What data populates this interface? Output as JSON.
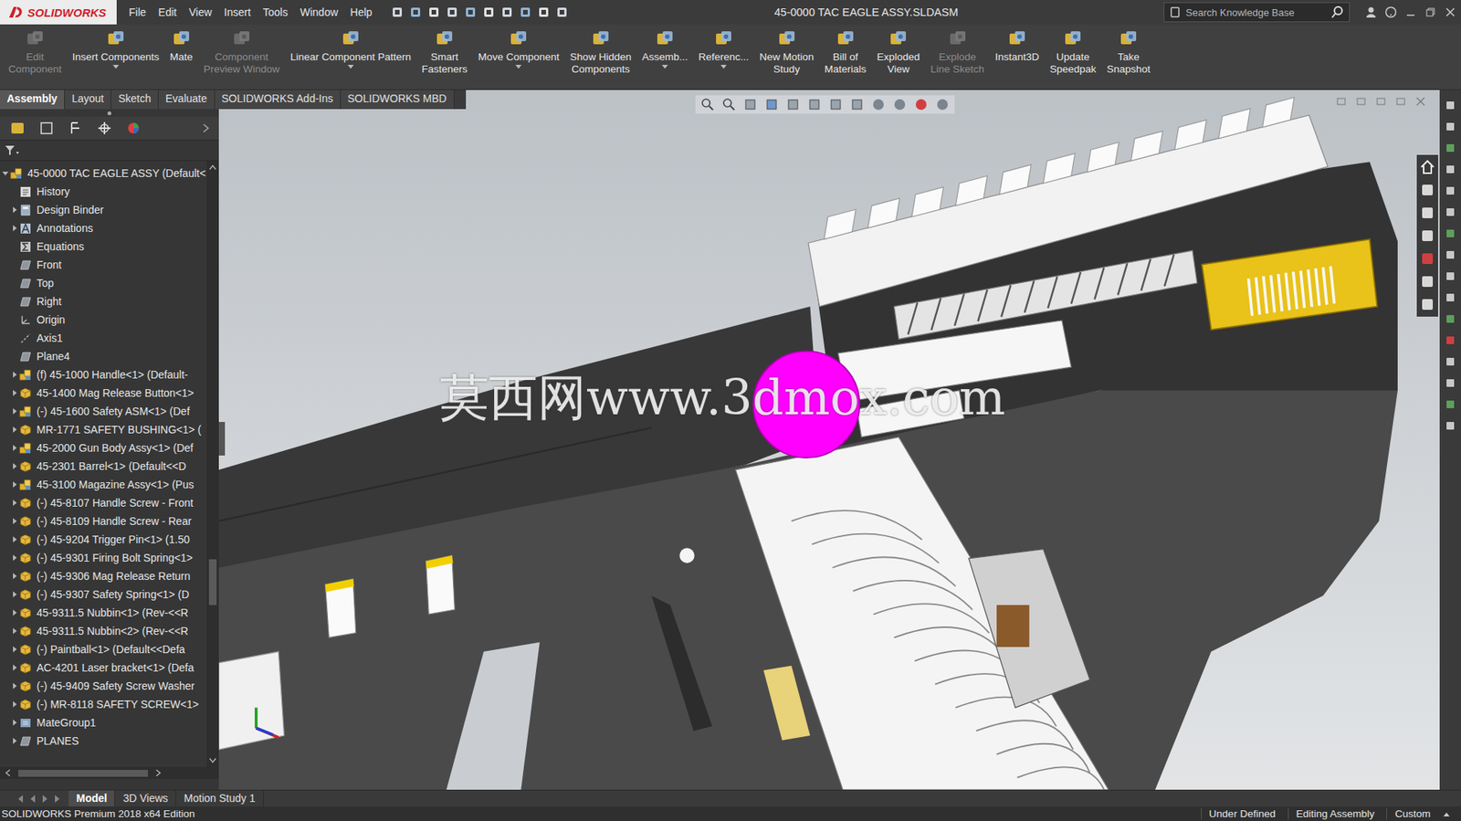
{
  "app": {
    "logo": "SOLIDWORKS",
    "title": "45-0000 TAC EAGLE ASSY.SLDASM",
    "menus": [
      "File",
      "Edit",
      "View",
      "Insert",
      "Tools",
      "Window",
      "Help"
    ],
    "search": {
      "placeholder": "Search Knowledge Base"
    }
  },
  "commands": [
    {
      "lines": [
        "Edit",
        "Component"
      ],
      "disabled": true,
      "dropdown": false
    },
    {
      "lines": [
        "Insert Components"
      ],
      "disabled": false,
      "dropdown": true
    },
    {
      "lines": [
        "Mate"
      ],
      "disabled": false,
      "dropdown": false
    },
    {
      "lines": [
        "Component",
        "Preview Window"
      ],
      "disabled": true,
      "dropdown": false
    },
    {
      "lines": [
        "Linear Component Pattern"
      ],
      "disabled": false,
      "dropdown": true
    },
    {
      "lines": [
        "Smart",
        "Fasteners"
      ],
      "disabled": false,
      "dropdown": false
    },
    {
      "lines": [
        "Move Component"
      ],
      "disabled": false,
      "dropdown": true
    },
    {
      "lines": [
        "Show Hidden",
        "Components"
      ],
      "disabled": false,
      "dropdown": false
    },
    {
      "lines": [
        "Assemb..."
      ],
      "disabled": false,
      "dropdown": true
    },
    {
      "lines": [
        "Referenc..."
      ],
      "disabled": false,
      "dropdown": true
    },
    {
      "lines": [
        "New Motion",
        "Study"
      ],
      "disabled": false,
      "dropdown": false
    },
    {
      "lines": [
        "Bill of",
        "Materials"
      ],
      "disabled": false,
      "dropdown": false
    },
    {
      "lines": [
        "Exploded",
        "View"
      ],
      "disabled": false,
      "dropdown": false
    },
    {
      "lines": [
        "Explode",
        "Line Sketch"
      ],
      "disabled": true,
      "dropdown": false
    },
    {
      "lines": [
        "Instant3D"
      ],
      "disabled": false,
      "dropdown": false
    },
    {
      "lines": [
        "Update",
        "Speedpak"
      ],
      "disabled": false,
      "dropdown": false
    },
    {
      "lines": [
        "Take",
        "Snapshot"
      ],
      "disabled": false,
      "dropdown": false
    }
  ],
  "tabs": [
    {
      "label": "Assembly",
      "selected": true
    },
    {
      "label": "Layout",
      "selected": false
    },
    {
      "label": "Sketch",
      "selected": false
    },
    {
      "label": "Evaluate",
      "selected": false
    },
    {
      "label": "SOLIDWORKS Add-Ins",
      "selected": false
    },
    {
      "label": "SOLIDWORKS MBD",
      "selected": false
    }
  ],
  "tree": {
    "items": [
      {
        "label": "45-0000 TAC EAGLE ASSY  (Default<",
        "kind": "assembly",
        "depth": 0,
        "expandable": true,
        "expanded": true
      },
      {
        "label": "History",
        "kind": "history",
        "depth": 1,
        "expandable": false,
        "expanded": false
      },
      {
        "label": "Design Binder",
        "kind": "binder",
        "depth": 1,
        "expandable": true,
        "expanded": false
      },
      {
        "label": "Annotations",
        "kind": "annotation",
        "depth": 1,
        "expandable": true,
        "expanded": false
      },
      {
        "label": "Equations",
        "kind": "equation",
        "depth": 1,
        "expandable": false,
        "expanded": false
      },
      {
        "label": "Front",
        "kind": "plane",
        "depth": 1,
        "expandable": false,
        "expanded": false
      },
      {
        "label": "Top",
        "kind": "plane",
        "depth": 1,
        "expandable": false,
        "expanded": false
      },
      {
        "label": "Right",
        "kind": "plane",
        "depth": 1,
        "expandable": false,
        "expanded": false
      },
      {
        "label": "Origin",
        "kind": "origin",
        "depth": 1,
        "expandable": false,
        "expanded": false
      },
      {
        "label": "Axis1",
        "kind": "axis",
        "depth": 1,
        "expandable": false,
        "expanded": false
      },
      {
        "label": "Plane4",
        "kind": "plane",
        "depth": 1,
        "expandable": false,
        "expanded": false
      },
      {
        "label": "(f) 45-1000 Handle<1> (Default-",
        "kind": "assembly",
        "depth": 1,
        "expandable": true,
        "expanded": false
      },
      {
        "label": "45-1400 Mag Release Button<1>",
        "kind": "part",
        "depth": 1,
        "expandable": true,
        "expanded": false
      },
      {
        "label": "(-) 45-1600 Safety ASM<1> (Def",
        "kind": "assembly",
        "depth": 1,
        "expandable": true,
        "expanded": false
      },
      {
        "label": "MR-1771 SAFETY BUSHING<1> (",
        "kind": "part",
        "depth": 1,
        "expandable": true,
        "expanded": false
      },
      {
        "label": "45-2000 Gun Body Assy<1> (Def",
        "kind": "assembly",
        "depth": 1,
        "expandable": true,
        "expanded": false
      },
      {
        "label": "45-2301 Barrel<1> (Default<<D",
        "kind": "part",
        "depth": 1,
        "expandable": true,
        "expanded": false
      },
      {
        "label": "45-3100 Magazine Assy<1> (Pus",
        "kind": "assembly",
        "depth": 1,
        "expandable": true,
        "expanded": false
      },
      {
        "label": "(-) 45-8107 Handle Screw - Front",
        "kind": "part",
        "depth": 1,
        "expandable": true,
        "expanded": false
      },
      {
        "label": "(-) 45-8109 Handle Screw - Rear",
        "kind": "part",
        "depth": 1,
        "expandable": true,
        "expanded": false
      },
      {
        "label": "(-) 45-9204 Trigger Pin<1> (1.50",
        "kind": "part",
        "depth": 1,
        "expandable": true,
        "expanded": false
      },
      {
        "label": "(-) 45-9301 Firing Bolt Spring<1>",
        "kind": "part",
        "depth": 1,
        "expandable": true,
        "expanded": false
      },
      {
        "label": "(-) 45-9306 Mag Release Return",
        "kind": "part",
        "depth": 1,
        "expandable": true,
        "expanded": false
      },
      {
        "label": "(-) 45-9307 Safety Spring<1> (D",
        "kind": "part",
        "depth": 1,
        "expandable": true,
        "expanded": false
      },
      {
        "label": "45-9311.5 Nubbin<1> (Rev-<<R",
        "kind": "part",
        "depth": 1,
        "expandable": true,
        "expanded": false
      },
      {
        "label": "45-9311.5 Nubbin<2> (Rev-<<R",
        "kind": "part",
        "depth": 1,
        "expandable": true,
        "expanded": false
      },
      {
        "label": "(-) Paintball<1> (Default<<Defa",
        "kind": "part",
        "depth": 1,
        "expandable": true,
        "expanded": false
      },
      {
        "label": "AC-4201 Laser bracket<1> (Defa",
        "kind": "part",
        "depth": 1,
        "expandable": true,
        "expanded": false
      },
      {
        "label": "(-) 45-9409 Safety Screw Washer",
        "kind": "part",
        "depth": 1,
        "expandable": true,
        "expanded": false
      },
      {
        "label": "(-) MR-8118 SAFETY SCREW<1>",
        "kind": "part",
        "depth": 1,
        "expandable": true,
        "expanded": false
      },
      {
        "label": "MateGroup1",
        "kind": "mategroup",
        "depth": 1,
        "expandable": true,
        "expanded": false
      },
      {
        "label": "PLANES",
        "kind": "plane",
        "depth": 1,
        "expandable": true,
        "expanded": false
      }
    ]
  },
  "watermark": "莫西网www.3dmox.com",
  "bottom_tabs": [
    {
      "label": "Model",
      "selected": true
    },
    {
      "label": "3D Views",
      "selected": false
    },
    {
      "label": "Motion Study 1",
      "selected": false
    }
  ],
  "status_bar": {
    "edition": "SOLIDWORKS Premium 2018 x64 Edition",
    "items": [
      "Under Defined",
      "Editing Assembly",
      "Custom"
    ]
  }
}
